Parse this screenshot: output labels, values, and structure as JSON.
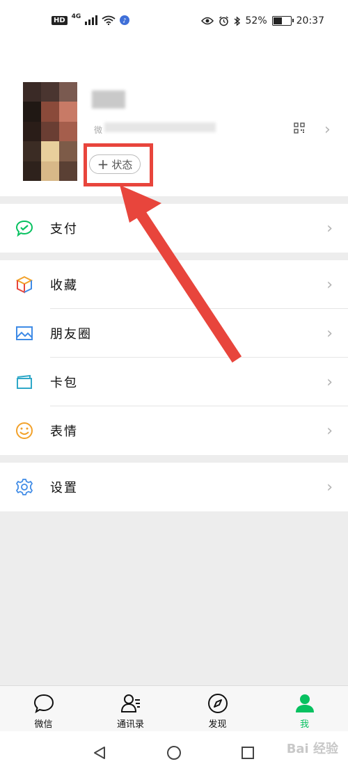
{
  "status_bar": {
    "left_badge": "HD",
    "network": "4G",
    "battery": "52%",
    "battery_level": 0.52,
    "time": "20:37"
  },
  "profile": {
    "wechat_id_prefix": "微",
    "status_button": "状态",
    "status_plus": "+"
  },
  "menu": {
    "pay": "支付",
    "favorites": "收藏",
    "moments": "朋友圈",
    "cards": "卡包",
    "stickers": "表情",
    "settings": "设置"
  },
  "tabs": [
    {
      "label": "微信",
      "icon": "chat-bubble-icon"
    },
    {
      "label": "通讯录",
      "icon": "contacts-icon"
    },
    {
      "label": "发现",
      "icon": "compass-icon"
    },
    {
      "label": "我",
      "icon": "person-icon",
      "active": true
    }
  ],
  "colors": {
    "accent": "#07c160",
    "highlight": "#e8453c"
  },
  "watermark": "Bai 经验"
}
